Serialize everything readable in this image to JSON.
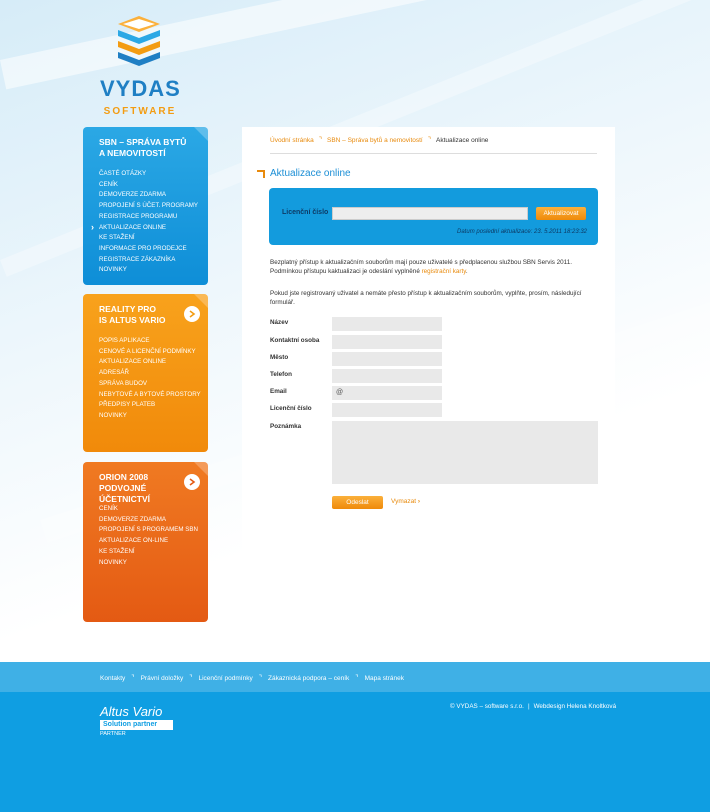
{
  "logo": {
    "name": "VYDAS",
    "sub": "SOFTWARE",
    "colors": {
      "primary": "#1f7fc4",
      "accent": "#f39c12"
    }
  },
  "sidebar": {
    "blue": {
      "title_line1": "SBN – SPRÁVA BYTŮ",
      "title_line2": "A NEMOVITOSTÍ",
      "items": [
        "ČASTÉ OTÁZKY",
        "CENÍK",
        "DEMOVERZE ZDARMA",
        "PROPOJENÍ S ÚČET. PROGRAMY",
        "REGISTRACE PROGRAMU",
        "AKTUALIZACE ONLINE",
        "KE STAŽENÍ",
        "INFORMACE PRO PRODEJCE",
        "REGISTRACE ZÁKAZNÍKA",
        "NOVINKY"
      ],
      "active_index": 5
    },
    "orange": {
      "title_line1": "REALITY PRO",
      "title_line2": "IS ALTUS VARIO",
      "items": [
        "POPIS APLIKACE",
        "CENOVÉ A LICENČNÍ PODMÍNKY",
        "AKTUALIZACE ONLINE",
        "ADRESÁŘ",
        "SPRÁVA BUDOV",
        "NEBYTOVÉ A BYTOVÉ PROSTORY",
        "PŘEDPISY PLATEB",
        "NOVINKY"
      ]
    },
    "red": {
      "title_line1": "ORION 2008",
      "title_line2": "PODVOJNÉ ÚČETNICTVÍ",
      "items": [
        "CENÍK",
        "DEMOVERZE ZDARMA",
        "PROPOJENÍ S PROGRAMEM SBN",
        "AKTUALIZACE ON-LINE",
        "KE STAŽENÍ",
        "NOVINKY"
      ]
    }
  },
  "breadcrumb": {
    "items": [
      "Úvodní stránka",
      "SBN – Správa bytů a nemovitostí"
    ],
    "current": "Aktualizace online"
  },
  "page_title": "Aktualizace online",
  "license": {
    "label": "Licenční číslo",
    "value": "",
    "button": "Aktualizovat",
    "last_update": "Datum poslední aktualizace: 23. 5.2011 18:23:32"
  },
  "intro": {
    "text1": "Bezplatný přístup k aktualizačním souborům mají pouze uživatelé s předplacenou službou SBN Servis 2011. Podmínkou přístupu kaktualizaci je odeslání vyplněné ",
    "link": "registrační karty",
    "text1_end": ".",
    "text2": "Pokud jste registrovaný uživatel a nemáte přesto přístup k aktualizačním souborům, vyplňte, prosím, následující formulář."
  },
  "form": {
    "fields": [
      {
        "label": "Název",
        "value": ""
      },
      {
        "label": "Kontaktní osoba",
        "value": ""
      },
      {
        "label": "Město",
        "value": ""
      },
      {
        "label": "Telefon",
        "value": ""
      },
      {
        "label": "Email",
        "value": "@"
      },
      {
        "label": "Licenční číslo",
        "value": ""
      }
    ],
    "note_label": "Poznámka",
    "send": "Odeslat",
    "clear": "Vymazat"
  },
  "footer": {
    "links": [
      "Kontakty",
      "Právní doložky",
      "Licenční podmínky",
      "Zákaznická podpora – ceník",
      "Mapa stránek"
    ],
    "partner_name": "Altus Vario",
    "partner_tag": "Solution partner",
    "partner_label": "PARTNER",
    "copyright": "© VYDAS – software s.r.o.",
    "webdesign": "Webdesign Helena Knoltková"
  }
}
